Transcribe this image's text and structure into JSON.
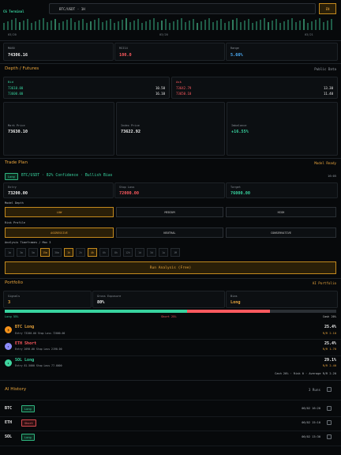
{
  "header": {
    "terminal": "CG Terminal",
    "pair_select": "BTC/USDT · 1H",
    "lang_button": "EN",
    "dates": [
      "03/20",
      "03/20",
      "03/21"
    ]
  },
  "stats": [
    {
      "label": "MA60",
      "value": "74306.16"
    },
    {
      "label": "RSI14",
      "value": "100.0"
    },
    {
      "label": "Range",
      "value": "5.66%"
    }
  ],
  "depth": {
    "title": "Depth / Futures",
    "right": "Public Data",
    "bid_label": "Bid",
    "bids": [
      {
        "price": "73610.00",
        "qty": "10.50"
      },
      {
        "price": "73600.00",
        "qty": "16.10"
      }
    ],
    "ask_label": "Ask",
    "asks": [
      {
        "price": "73642.79",
        "qty": "13.30"
      },
      {
        "price": "73650.10",
        "qty": "11.40"
      }
    ],
    "mark_label": "Mark Price",
    "mark_value": "73630.10",
    "index_label": "Index Price",
    "index_value": "73622.92",
    "imb_label": "Imbalance",
    "imb_value": "+16.55%"
  },
  "plan": {
    "title": "Trade Plan",
    "right": "Model Ready",
    "side": "Long",
    "summary": "BTC/USDT · 82% Confidence · Bullish Bias",
    "time": "16:05",
    "entry_label": "Entry",
    "entry_value": "73200.00",
    "stop_label": "Stop Loss",
    "stop_value": "72000.00",
    "target_label": "Target",
    "target_value": "76000.00",
    "depth_label": "Model Depth",
    "depth_opts": [
      "LOW",
      "MEDIUM",
      "HIGH"
    ],
    "risk_label": "Risk Profile",
    "risk_opts": [
      "AGGRESSIVE",
      "NEUTRAL",
      "CONSERVATIVE"
    ],
    "tf_label": "Analysis Timeframes / Max 3",
    "timeframes": [
      "1m",
      "3m",
      "5m",
      "15m",
      "30m",
      "1h",
      "2h",
      "4h",
      "6h",
      "8h",
      "12h",
      "1d",
      "3d",
      "1w",
      "1M"
    ],
    "tf_selected": [
      "15m",
      "1h",
      "4h"
    ],
    "run_button": "Run Analysis (Free)"
  },
  "portfolio": {
    "title": "Portfolio",
    "right": "AI Portfolio",
    "signals_label": "Signals",
    "signals_value": "3",
    "exposure_label": "Gross Exposure",
    "exposure_value": "80%",
    "bias_label": "Bias",
    "bias_value": "Long",
    "long_pct": 55,
    "short_pct": 25,
    "cash_pct": 20,
    "bar_long_label": "Long 55%",
    "bar_short_label": "Short 25%",
    "bar_cash_label": "Cash 20%",
    "positions": [
      {
        "coin": "BTC",
        "side": "Long",
        "color": "#f7931a",
        "detail": "Entry 73200.00    Stop Loss 72000.00",
        "weight": "25.4%",
        "rr": "R/R 2.10"
      },
      {
        "coin": "ETH",
        "side": "Short",
        "color": "#8c8cff",
        "detail": "Entry 2090.00    Stop Loss 2190.00",
        "weight": "25.4%",
        "rr": "R/R 1.70"
      },
      {
        "coin": "SOL",
        "side": "Long",
        "color": "#3fd6a0",
        "detail": "Entry 81.5000    Stop Loss 77.0000",
        "weight": "29.1%",
        "rr": "R/R 2.40"
      }
    ],
    "footer": "Cash 20% · Risk 0 · Average R/R 2.20"
  },
  "history": {
    "title": "AI History",
    "right": "3 Runs",
    "rows": [
      {
        "coin": "BTC",
        "side": "Long",
        "time": "06/02 16:20"
      },
      {
        "coin": "ETH",
        "side": "Short",
        "time": "06/02 15:10"
      },
      {
        "coin": "SOL",
        "side": "Long",
        "time": "06/02 13:30"
      }
    ]
  },
  "colors": {
    "accent": "#e8a43c",
    "long": "#38d39f",
    "short": "#ff5a5f"
  }
}
